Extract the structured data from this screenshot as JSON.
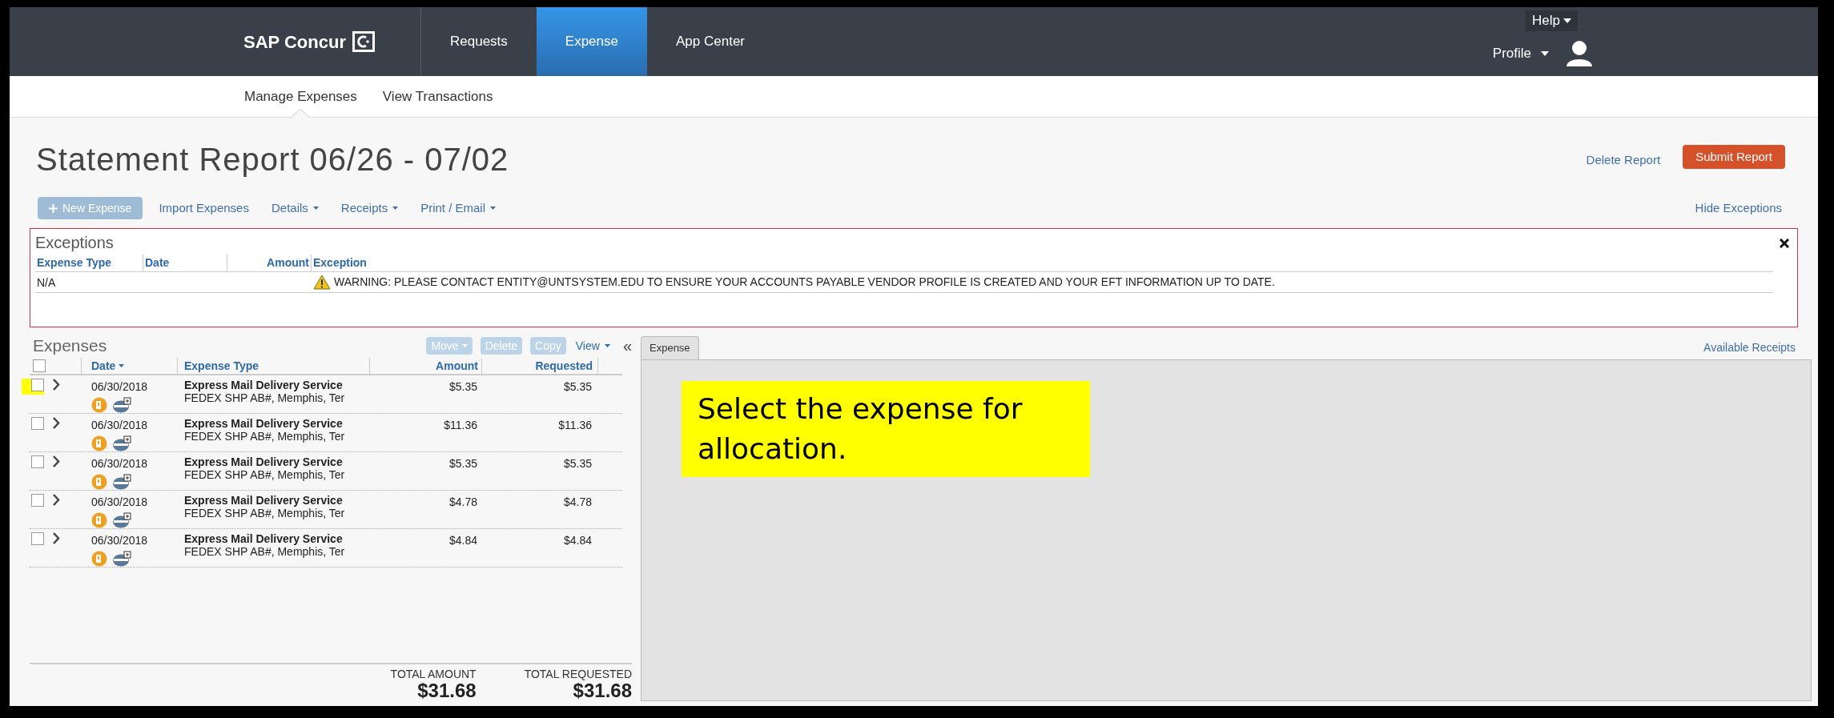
{
  "top_bar": {
    "logo": "SAP Concur",
    "nav": [
      {
        "label": "Requests",
        "selected": false
      },
      {
        "label": "Expense",
        "selected": true
      },
      {
        "label": "App Center",
        "selected": false
      }
    ],
    "help": "Help",
    "profile": "Profile"
  },
  "sub_nav": [
    {
      "label": "Manage Expenses",
      "selected": true
    },
    {
      "label": "View Transactions",
      "selected": false
    }
  ],
  "title": "Statement Report 06/26 - 07/02",
  "header_actions": {
    "delete": "Delete Report",
    "submit": "Submit Report"
  },
  "toolbar": [
    {
      "label": "New Expense",
      "kind": "button",
      "disabled": true
    },
    {
      "label": "Import Expenses",
      "kind": "link"
    },
    {
      "label": "Details",
      "kind": "menu"
    },
    {
      "label": "Receipts",
      "kind": "menu"
    },
    {
      "label": "Print / Email",
      "kind": "menu"
    }
  ],
  "hide_exceptions": "Hide Exceptions",
  "exceptions": {
    "title": "Exceptions",
    "columns": [
      "Expense Type",
      "Date",
      "Amount",
      "Exception"
    ],
    "rows": [
      {
        "expense_type": "N/A",
        "exception": "WARNING: PLEASE CONTACT ENTITY@UNTSYSTEM.EDU TO ENSURE YOUR ACCOUNTS PAYABLE VENDOR PROFILE IS CREATED AND YOUR EFT INFORMATION UP TO DATE."
      }
    ]
  },
  "expenses": {
    "title": "Expenses",
    "actions": [
      {
        "label": "Move",
        "kind": "menu",
        "disabled": true
      },
      {
        "label": "Delete",
        "kind": "button",
        "disabled": true
      },
      {
        "label": "Copy",
        "kind": "button",
        "disabled": true
      },
      {
        "label": "View",
        "kind": "menu",
        "disabled": false
      }
    ],
    "collapse": "«",
    "columns": [
      "Date",
      "Expense Type",
      "Amount",
      "Requested"
    ],
    "select_all_checked": false,
    "rows": [
      {
        "checked": false,
        "highlighted": true,
        "date": "06/30/2018",
        "type": "Express Mail Delivery Service",
        "vendor": "FEDEX SHP AB#, Memphis, Ter",
        "amount": "$5.35",
        "requested": "$5.35"
      },
      {
        "checked": false,
        "highlighted": false,
        "date": "06/30/2018",
        "type": "Express Mail Delivery Service",
        "vendor": "FEDEX SHP AB#, Memphis, Ter",
        "amount": "$11.36",
        "requested": "$11.36"
      },
      {
        "checked": false,
        "highlighted": false,
        "date": "06/30/2018",
        "type": "Express Mail Delivery Service",
        "vendor": "FEDEX SHP AB#, Memphis, Ter",
        "amount": "$5.35",
        "requested": "$5.35"
      },
      {
        "checked": false,
        "highlighted": false,
        "date": "06/30/2018",
        "type": "Express Mail Delivery Service",
        "vendor": "FEDEX SHP AB#, Memphis, Ter",
        "amount": "$4.78",
        "requested": "$4.78"
      },
      {
        "checked": false,
        "highlighted": false,
        "date": "06/30/2018",
        "type": "Express Mail Delivery Service",
        "vendor": "FEDEX SHP AB#, Memphis, Ter",
        "amount": "$4.84",
        "requested": "$4.84"
      }
    ],
    "totals": [
      {
        "label": "TOTAL AMOUNT",
        "value": "$31.68"
      },
      {
        "label": "TOTAL REQUESTED",
        "value": "$31.68"
      }
    ]
  },
  "detail": {
    "tab": "Expense",
    "available_receipts": "Available Receipts",
    "callout": "Select the expense for allocation."
  }
}
